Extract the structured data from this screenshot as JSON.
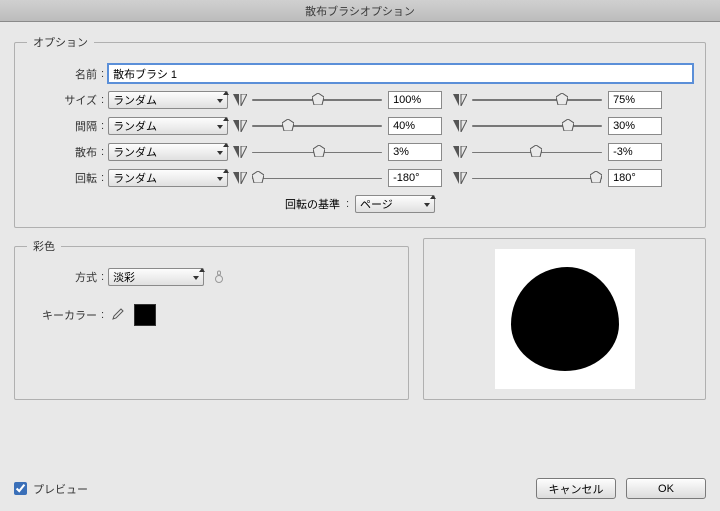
{
  "title": "散布ブラシオプション",
  "options": {
    "legend": "オプション",
    "name_label": "名前",
    "name_value": "散布ブラシ 1",
    "size": {
      "label": "サイズ",
      "mode": "ランダム",
      "v1": "100%",
      "v2": "75%"
    },
    "spacing": {
      "label": "間隔",
      "mode": "ランダム",
      "v1": "40%",
      "v2": "30%"
    },
    "scatter": {
      "label": "散布",
      "mode": "ランダム",
      "v1": "3%",
      "v2": "-3%"
    },
    "rotation": {
      "label": "回転",
      "mode": "ランダム",
      "v1": "-180°",
      "v2": "180°"
    },
    "rotation_basis": {
      "label": "回転の基準",
      "value": "ページ"
    }
  },
  "color": {
    "legend": "彩色",
    "method_label": "方式",
    "method_value": "淡彩",
    "keycolor_label": "キーカラー",
    "keycolor_hex": "#000000"
  },
  "footer": {
    "preview_label": "プレビュー",
    "cancel": "キャンセル",
    "ok": "OK"
  }
}
